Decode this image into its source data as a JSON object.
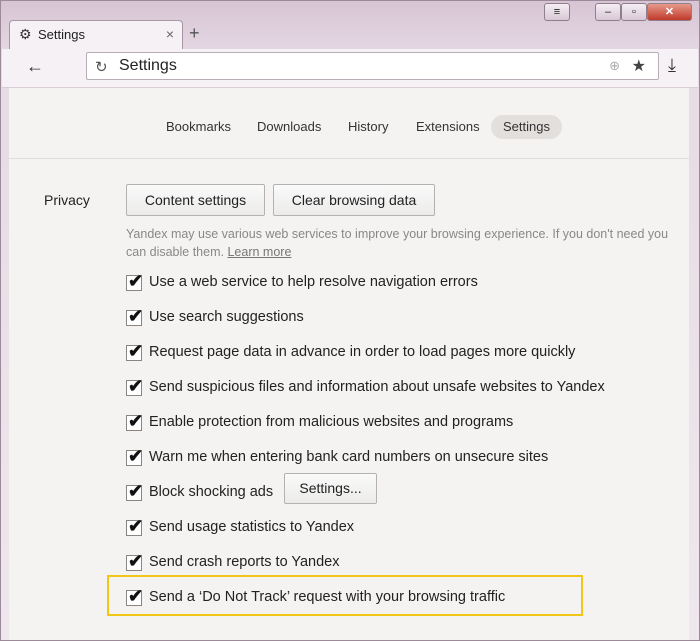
{
  "window": {
    "tab_title": "Settings",
    "new_tab": "+",
    "tab_close": "×",
    "menu_glyph": "≡",
    "minimize_glyph": "–",
    "restore_glyph": "▫",
    "close_glyph": "✕"
  },
  "toolbar": {
    "back_glyph": "←",
    "address": "Settings",
    "reload_glyph": "↻",
    "globe_glyph": "⊕",
    "star_glyph": "★",
    "download_glyph": "⤓"
  },
  "nav": {
    "items": [
      "Bookmarks",
      "Downloads",
      "History",
      "Extensions",
      "Settings"
    ],
    "active": "Settings"
  },
  "privacy": {
    "label": "Privacy",
    "content_settings": "Content settings",
    "clear_browsing_data": "Clear browsing data",
    "note": "Yandex may use various web services to improve your browsing experience. If you don't need you can disable them.",
    "learn_more": "Learn more",
    "options": [
      {
        "label": "Use a web service to help resolve navigation errors",
        "checked": true
      },
      {
        "label": "Use search suggestions",
        "checked": true
      },
      {
        "label": "Request page data in advance in order to load pages more quickly",
        "checked": true
      },
      {
        "label": "Send suspicious files and information about unsafe websites to Yandex",
        "checked": true
      },
      {
        "label": "Enable protection from malicious websites and programs",
        "checked": true
      },
      {
        "label": "Warn me when entering bank card numbers on unsecure sites",
        "checked": true
      },
      {
        "label": "Block shocking ads",
        "checked": true
      },
      {
        "label": "Send usage statistics to Yandex",
        "checked": true
      },
      {
        "label": "Send crash reports to Yandex",
        "checked": true
      },
      {
        "label": "Send a ‘Do Not Track’ request with your browsing traffic",
        "checked": true
      }
    ],
    "shocking_ads_settings": "Settings..."
  },
  "colors": {
    "highlight": "#f2c619"
  }
}
